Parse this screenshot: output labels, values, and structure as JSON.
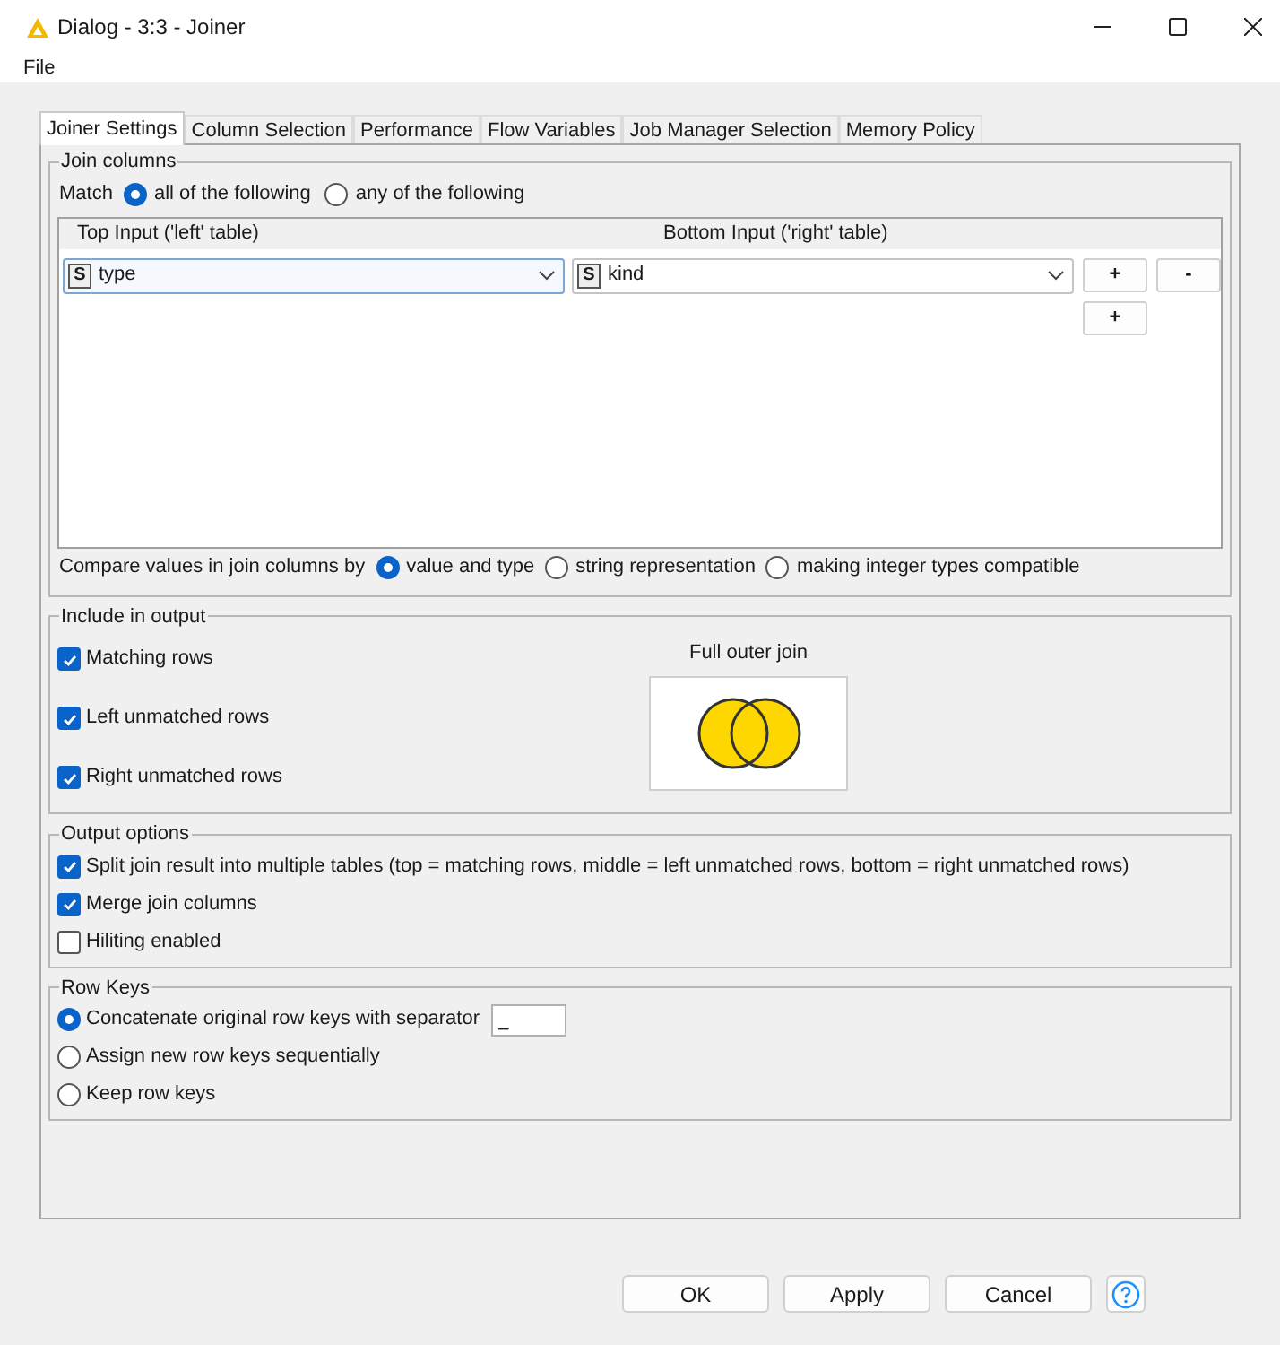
{
  "window": {
    "title": "Dialog - 3:3 - Joiner"
  },
  "menu": [
    "File"
  ],
  "tabs": [
    {
      "label": "Joiner Settings",
      "selected": true
    },
    {
      "label": "Column Selection",
      "selected": false
    },
    {
      "label": "Performance",
      "selected": false
    },
    {
      "label": "Flow Variables",
      "selected": false
    },
    {
      "label": "Job Manager Selection",
      "selected": false
    },
    {
      "label": "Memory Policy",
      "selected": false
    }
  ],
  "join_columns": {
    "title": "Join columns",
    "match_label": "Match",
    "match_options": [
      {
        "label": "all of the following",
        "selected": true
      },
      {
        "label": "any of the following",
        "selected": false
      }
    ],
    "columns": [
      "Top Input ('left' table)",
      "Bottom Input ('right' table)"
    ],
    "rows": [
      {
        "left": {
          "type_badge": "S",
          "value": "type"
        },
        "right": {
          "type_badge": "S",
          "value": "kind"
        },
        "buttons": [
          "+",
          "-"
        ]
      }
    ],
    "add_button": "+",
    "compare_label": "Compare values in join columns by",
    "compare_options": [
      {
        "label": "value and type",
        "selected": true
      },
      {
        "label": "string representation",
        "selected": false
      },
      {
        "label": "making integer types compatible",
        "selected": false
      }
    ]
  },
  "include_in_output": {
    "title": "Include in output",
    "options": [
      {
        "label": "Matching rows",
        "checked": true
      },
      {
        "label": "Left unmatched rows",
        "checked": true
      },
      {
        "label": "Right unmatched rows",
        "checked": true
      }
    ],
    "join_type": "Full outer join"
  },
  "output_options": {
    "title": "Output options",
    "options": [
      {
        "label": "Split join result into multiple tables (top = matching rows, middle = left unmatched rows, bottom = right unmatched rows)",
        "checked": true
      },
      {
        "label": "Merge join columns",
        "checked": true
      },
      {
        "label": "Hiliting enabled",
        "checked": false
      }
    ]
  },
  "row_keys": {
    "title": "Row Keys",
    "options": [
      {
        "label": "Concatenate original row keys with separator",
        "selected": true,
        "separator": "_"
      },
      {
        "label": "Assign new row keys sequentially",
        "selected": false
      },
      {
        "label": "Keep row keys",
        "selected": false
      }
    ]
  },
  "buttons": [
    "OK",
    "Apply",
    "Cancel"
  ]
}
